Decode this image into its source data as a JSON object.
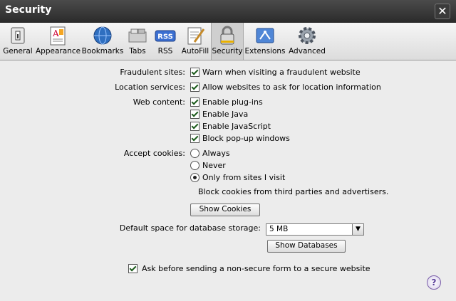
{
  "window": {
    "title": "Security",
    "close_glyph": "✕"
  },
  "toolbar": {
    "items": [
      {
        "label": "General",
        "icon": "general-icon"
      },
      {
        "label": "Appearance",
        "icon": "appearance-icon"
      },
      {
        "label": "Bookmarks",
        "icon": "bookmarks-globe-icon"
      },
      {
        "label": "Tabs",
        "icon": "tabs-icon"
      },
      {
        "label": "RSS",
        "icon": "rss-icon"
      },
      {
        "label": "AutoFill",
        "icon": "autofill-icon"
      },
      {
        "label": "Security",
        "icon": "lock-icon",
        "selected": true
      },
      {
        "label": "Extensions",
        "icon": "extensions-icon"
      },
      {
        "label": "Advanced",
        "icon": "gear-icon"
      }
    ],
    "rss_badge": "RSS"
  },
  "fraudulent": {
    "label": "Fraudulent sites:",
    "option": "Warn when visiting a fraudulent website",
    "checked": true
  },
  "location": {
    "label": "Location services:",
    "option": "Allow websites to ask for location information",
    "checked": true
  },
  "web_content": {
    "label": "Web content:",
    "options": [
      {
        "label": "Enable plug-ins",
        "checked": true
      },
      {
        "label": "Enable Java",
        "checked": true
      },
      {
        "label": "Enable JavaScript",
        "checked": true
      },
      {
        "label": "Block pop-up windows",
        "checked": true
      }
    ]
  },
  "cookies": {
    "label": "Accept cookies:",
    "options": [
      {
        "label": "Always",
        "selected": false
      },
      {
        "label": "Never",
        "selected": false
      },
      {
        "label": "Only from sites I visit",
        "selected": true
      }
    ],
    "note": "Block cookies from third parties and advertisers.",
    "show_button": "Show Cookies"
  },
  "database": {
    "label": "Default space for database storage:",
    "value": "5 MB",
    "show_button": "Show Databases"
  },
  "secure_form": {
    "label": "Ask before sending a non-secure form to a secure website",
    "checked": true
  },
  "help": {
    "glyph": "?"
  }
}
